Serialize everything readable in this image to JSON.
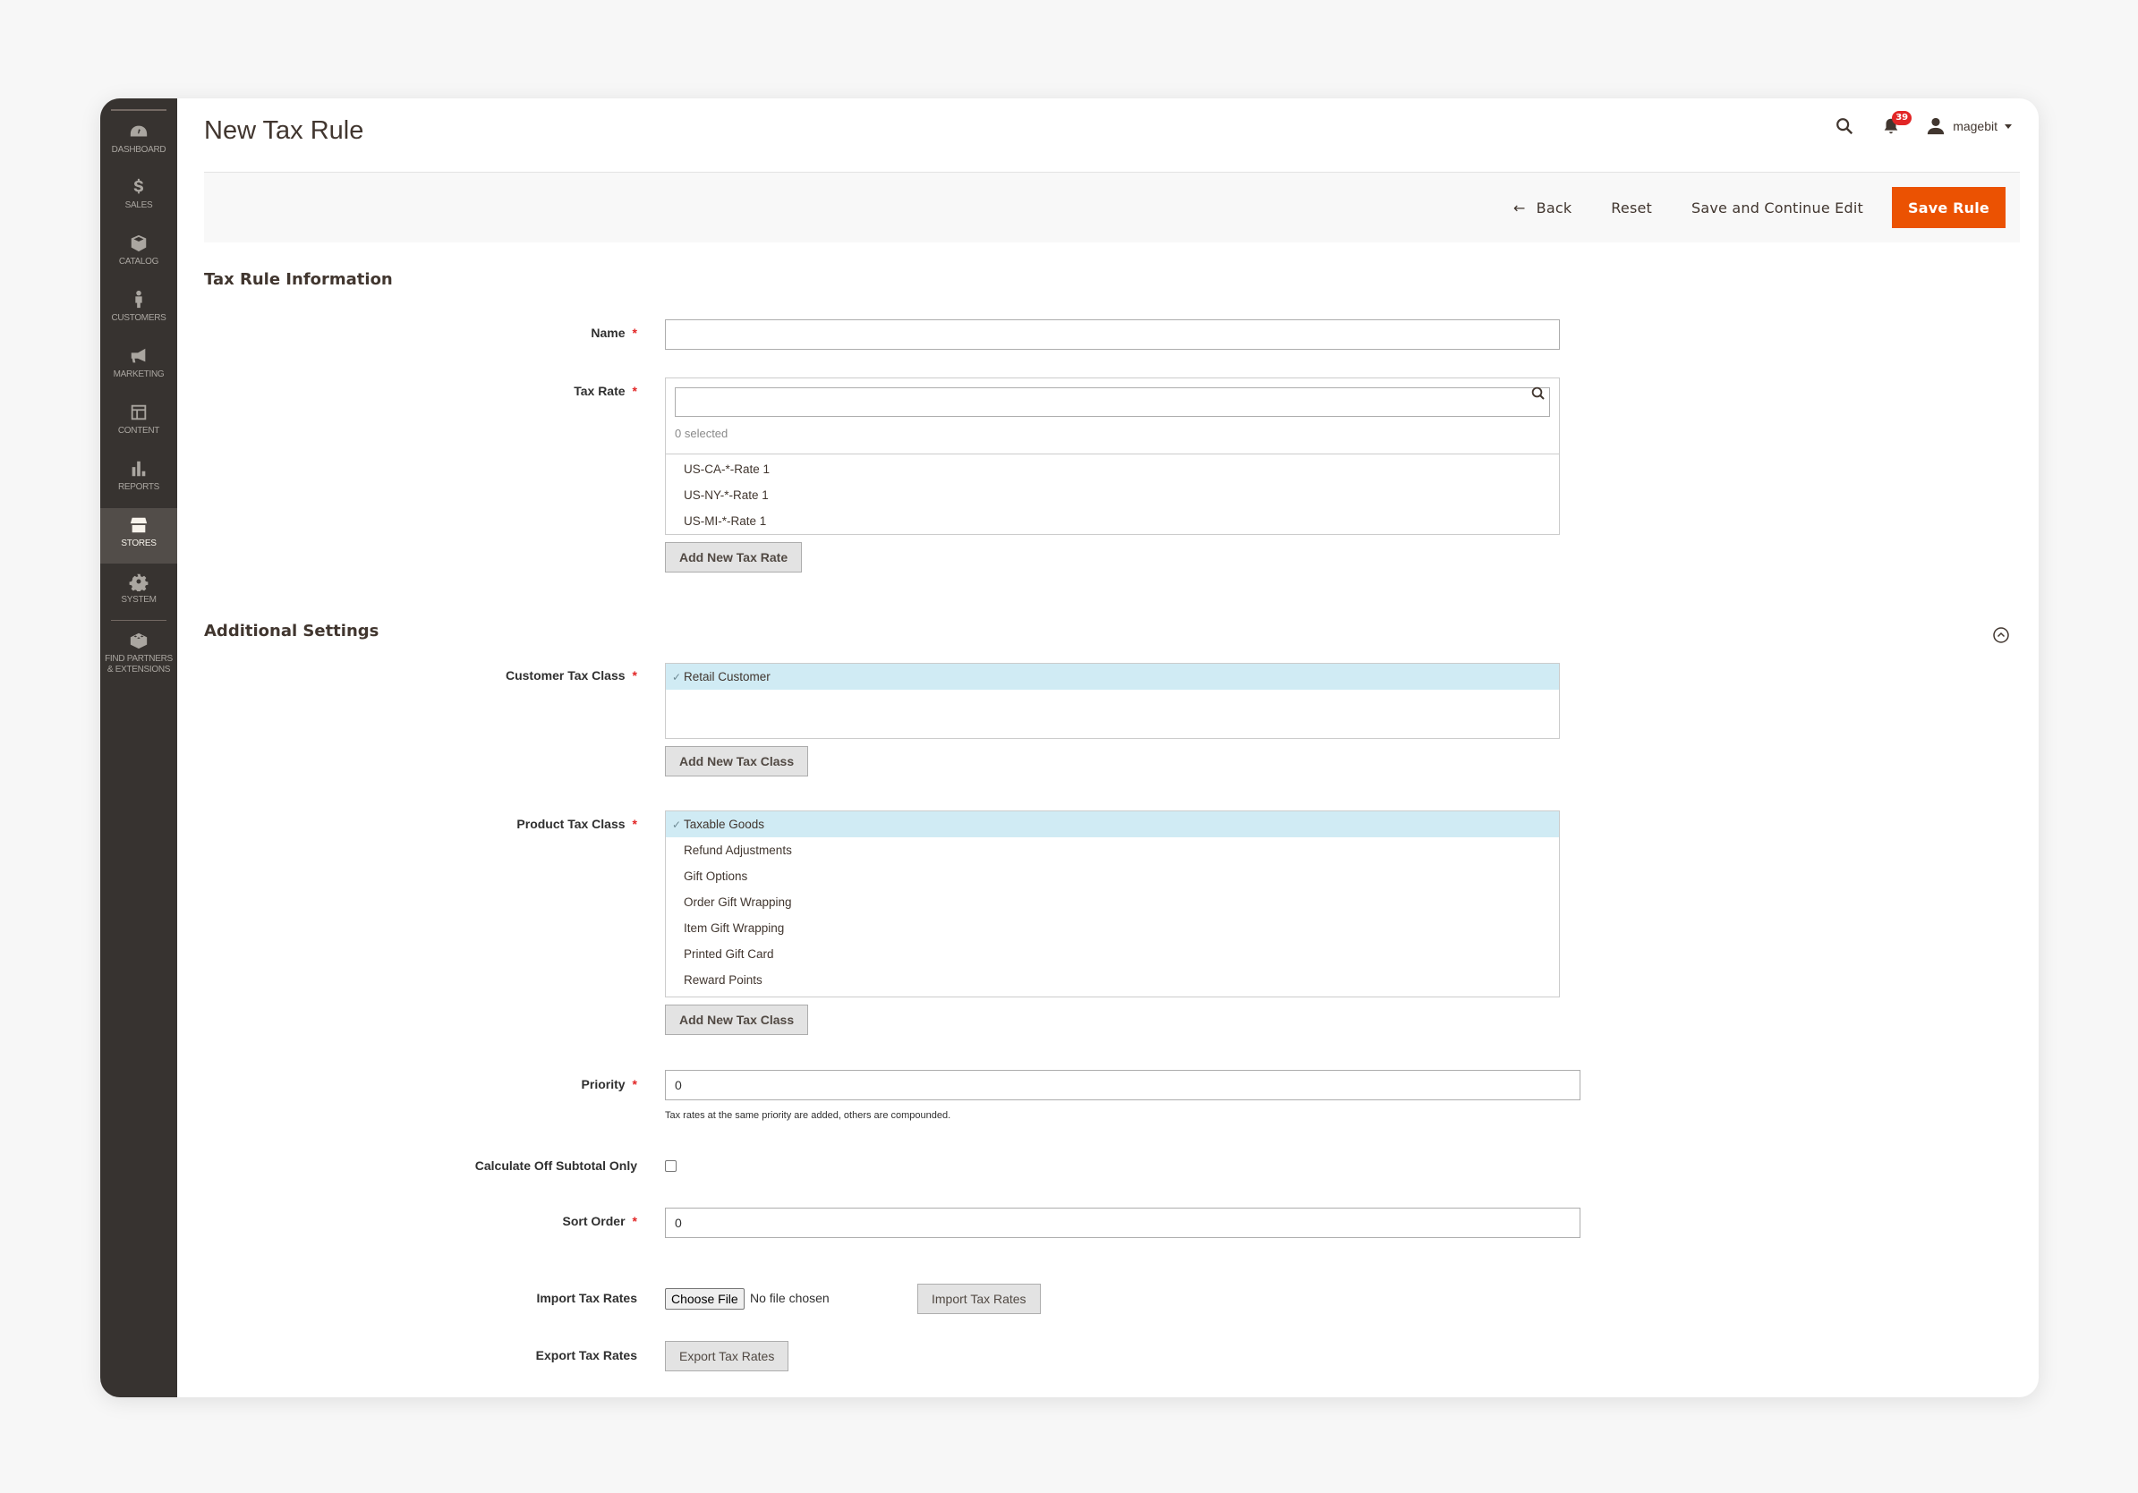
{
  "sidebar": {
    "items": [
      {
        "label": "Dashboard",
        "icon": "dashboard-icon"
      },
      {
        "label": "Sales",
        "icon": "dollar-icon"
      },
      {
        "label": "Catalog",
        "icon": "box-icon"
      },
      {
        "label": "Customers",
        "icon": "person-icon"
      },
      {
        "label": "Marketing",
        "icon": "megaphone-icon"
      },
      {
        "label": "Content",
        "icon": "layout-icon"
      },
      {
        "label": "Reports",
        "icon": "bar-chart-icon"
      },
      {
        "label": "Stores",
        "icon": "store-icon",
        "active": true
      },
      {
        "label": "System",
        "icon": "gear-icon"
      },
      {
        "label": "Find Partners & Extensions",
        "icon": "lego-block-icon"
      }
    ]
  },
  "header": {
    "title": "New Tax Rule",
    "notifications_count": "39",
    "user_name": "magebit"
  },
  "actions": {
    "back": "Back",
    "reset": "Reset",
    "save_continue": "Save and Continue Edit",
    "save_rule": "Save Rule"
  },
  "colors": {
    "primary": "#eb5202",
    "sidebar": "#373330",
    "selected_option": "#d0ebf4",
    "required": "#e22626"
  },
  "tax_rule_info": {
    "section_title": "Tax Rule Information",
    "name_label": "Name",
    "name_value": "",
    "tax_rate_label": "Tax Rate",
    "tax_rate_search_value": "",
    "selected_count": "0 selected",
    "tax_rates": [
      "US-CA-*-Rate 1",
      "US-NY-*-Rate 1",
      "US-MI-*-Rate 1"
    ],
    "add_tax_rate_button": "Add New Tax Rate"
  },
  "additional_settings": {
    "section_title": "Additional Settings",
    "customer_tax_class_label": "Customer Tax Class",
    "customer_tax_classes": [
      {
        "label": "Retail Customer",
        "selected": true
      }
    ],
    "add_customer_tax_class_button": "Add New Tax Class",
    "product_tax_class_label": "Product Tax Class",
    "product_tax_classes": [
      {
        "label": "Taxable Goods",
        "selected": true
      },
      {
        "label": "Refund Adjustments",
        "selected": false
      },
      {
        "label": "Gift Options",
        "selected": false
      },
      {
        "label": "Order Gift Wrapping",
        "selected": false
      },
      {
        "label": "Item Gift Wrapping",
        "selected": false
      },
      {
        "label": "Printed Gift Card",
        "selected": false
      },
      {
        "label": "Reward Points",
        "selected": false
      }
    ],
    "add_product_tax_class_button": "Add New Tax Class",
    "priority_label": "Priority",
    "priority_value": "0",
    "priority_note": "Tax rates at the same priority are added, others are compounded.",
    "calc_subtotal_label": "Calculate Off Subtotal Only",
    "calc_subtotal_checked": false,
    "sort_order_label": "Sort Order",
    "sort_order_value": "0",
    "import_label": "Import Tax Rates",
    "choose_file_button": "Choose File",
    "no_file_text": "No file chosen",
    "import_button": "Import Tax Rates",
    "export_label": "Export Tax Rates",
    "export_button": "Export Tax Rates"
  }
}
